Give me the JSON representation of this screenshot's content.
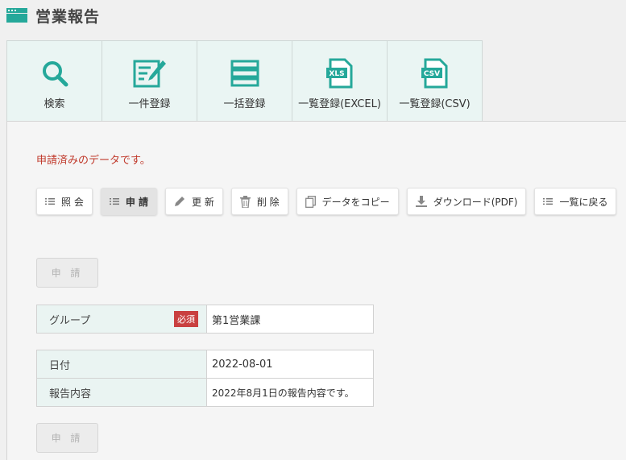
{
  "header": {
    "title": "営業報告"
  },
  "tabs": [
    {
      "label": "検索",
      "icon": "search-icon"
    },
    {
      "label": "一件登録",
      "icon": "edit-form-icon"
    },
    {
      "label": "一括登録",
      "icon": "list-rows-icon"
    },
    {
      "label": "一覧登録(EXCEL)",
      "icon": "xls-file-icon",
      "badge": "XLS"
    },
    {
      "label": "一覧登録(CSV)",
      "icon": "csv-file-icon",
      "badge": "CSV"
    }
  ],
  "notice": "申請済みのデータです。",
  "toolbar": {
    "view": "照 会",
    "apply": "申 請",
    "update": "更 新",
    "delete": "削 除",
    "copy": "データをコピー",
    "download": "ダウンロード(PDF)",
    "back": "一覧に戻る"
  },
  "apply_button": "申 請",
  "form": {
    "group_label": "グループ",
    "required_badge": "必須",
    "group_value": "第1営業課",
    "date_label": "日付",
    "date_value": "2022-08-01",
    "content_label": "報告内容",
    "content_value": "2022年8月1日の報告内容です。"
  },
  "colors": {
    "accent": "#25a89a",
    "notice": "#c0392b",
    "required": "#c94040"
  }
}
